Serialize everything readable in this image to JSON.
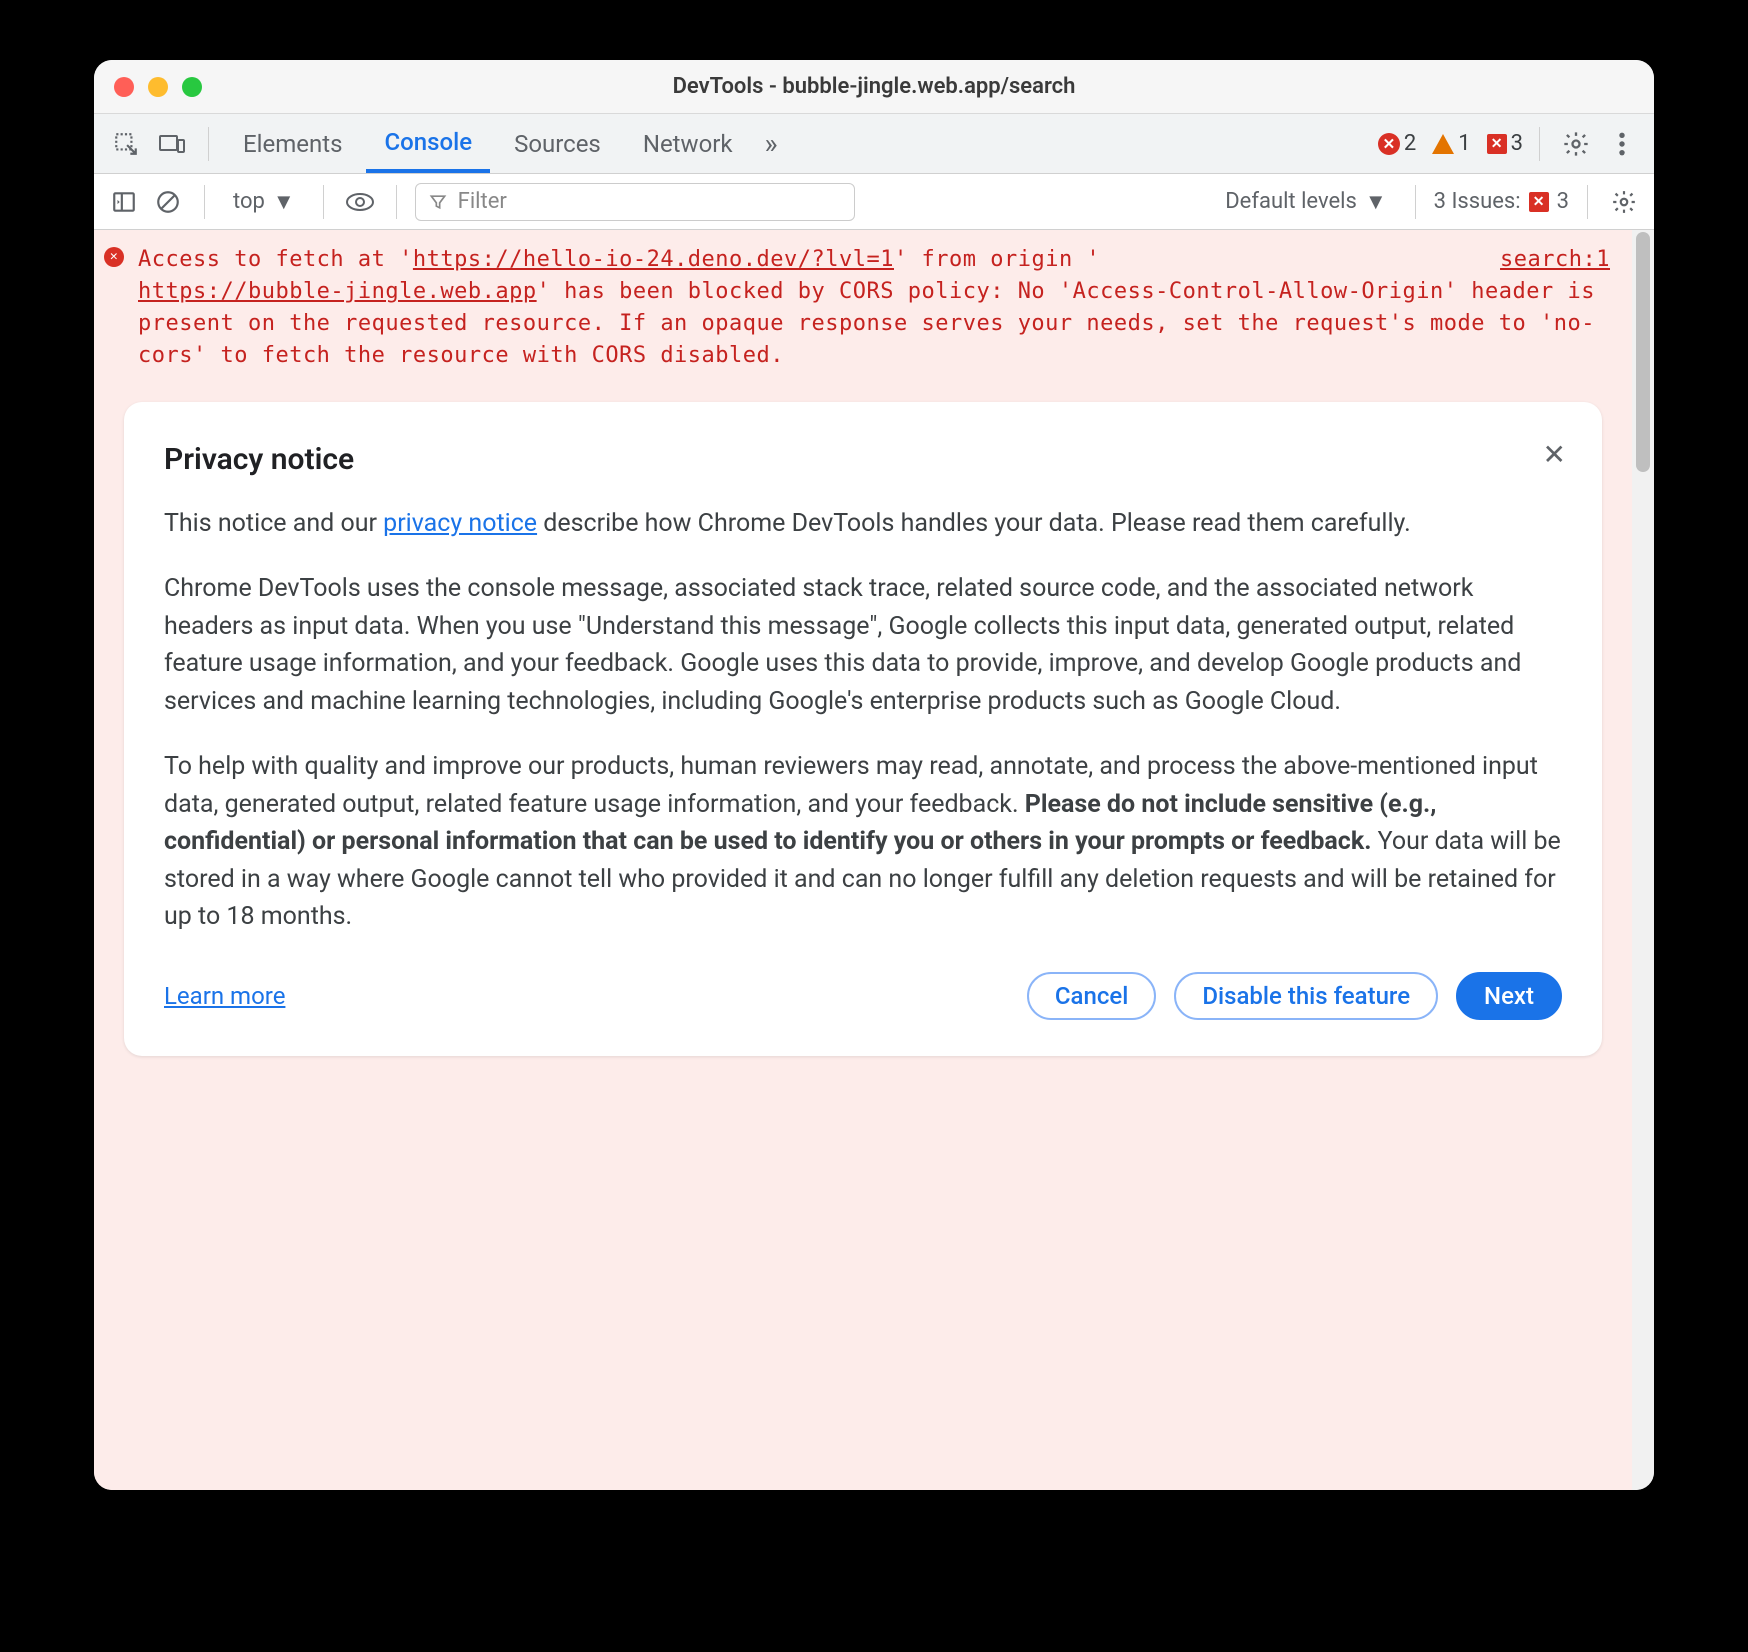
{
  "window": {
    "title": "DevTools - bubble-jingle.web.app/search"
  },
  "tabs": {
    "items": [
      "Elements",
      "Console",
      "Sources",
      "Network"
    ],
    "active_index": 1,
    "more_glyph": "»"
  },
  "status": {
    "errors": "2",
    "warnings": "1",
    "issues": "3"
  },
  "toolbar": {
    "context": "top",
    "filter_placeholder": "Filter",
    "levels": "Default levels",
    "issues_label": "3 Issues:",
    "issues_count": "3"
  },
  "console_error": {
    "source": "search:1",
    "pre": "Access to fetch at '",
    "url1": "https://hello-io-24.deno.dev/?lvl=1",
    "mid1": "' from origin '",
    "url2": "https://bubble-jingle.web.app",
    "rest": "' has been blocked by CORS policy: No 'Access-Control-Allow-Origin' header is present on the requested resource. If an opaque response serves your needs, set the request's mode to 'no-cors' to fetch the resource with CORS disabled."
  },
  "card": {
    "heading": "Privacy notice",
    "p1_a": "This notice and our ",
    "p1_link": "privacy notice",
    "p1_b": " describe how Chrome DevTools handles your data. Please read them carefully.",
    "p2": "Chrome DevTools uses the console message, associated stack trace, related source code, and the associated network headers as input data. When you use \"Understand this message\", Google collects this input data, generated output, related feature usage information, and your feedback. Google uses this data to provide, improve, and develop Google products and services and machine learning technologies, including Google's enterprise products such as Google Cloud.",
    "p3_a": "To help with quality and improve our products, human reviewers may read, annotate, and process the above-mentioned input data, generated output, related feature usage information, and your feedback. ",
    "p3_bold": "Please do not include sensitive (e.g., confidential) or personal information that can be used to identify you or others in your prompts or feedback.",
    "p3_b": " Your data will be stored in a way where Google cannot tell who provided it and can no longer fulfill any deletion requests and will be retained for up to 18 months.",
    "learn_more": "Learn more",
    "cancel": "Cancel",
    "disable": "Disable this feature",
    "next": "Next"
  }
}
